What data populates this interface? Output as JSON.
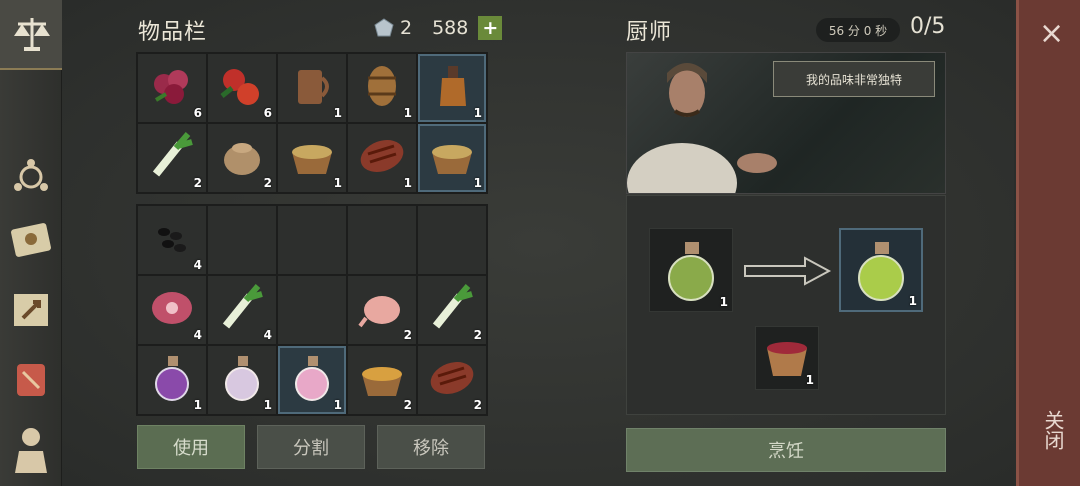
{
  "inventory": {
    "title": "物品栏",
    "gems": "2",
    "coins": "588",
    "add_label": "+",
    "row1": [
      {
        "icon": "berries-icon",
        "count": "6"
      },
      {
        "icon": "apples-icon",
        "count": "6"
      },
      {
        "icon": "mug-icon",
        "count": "1"
      },
      {
        "icon": "barrel-icon",
        "count": "1"
      },
      {
        "icon": "flask-icon",
        "count": "1",
        "selected": true
      }
    ],
    "row2": [
      {
        "icon": "leek-icon",
        "count": "2"
      },
      {
        "icon": "flour-sack-icon",
        "count": "2"
      },
      {
        "icon": "stew-bowl-icon",
        "count": "1"
      },
      {
        "icon": "steak-icon",
        "count": "1"
      },
      {
        "icon": "stew-bowl-icon",
        "count": "1",
        "selected": true
      }
    ],
    "row3": [
      {
        "icon": "black-seeds-icon",
        "count": "4"
      },
      {
        "icon": "",
        "count": ""
      },
      {
        "icon": "",
        "count": ""
      },
      {
        "icon": "",
        "count": ""
      },
      {
        "icon": "",
        "count": ""
      }
    ],
    "row4": [
      {
        "icon": "raw-meat-icon",
        "count": "4"
      },
      {
        "icon": "leek-icon",
        "count": "4"
      },
      {
        "icon": "",
        "count": ""
      },
      {
        "icon": "raw-chicken-icon",
        "count": "2"
      },
      {
        "icon": "leek-icon",
        "count": "2"
      }
    ],
    "row5": [
      {
        "icon": "purple-potion-icon",
        "count": "1"
      },
      {
        "icon": "white-potion-icon",
        "count": "1"
      },
      {
        "icon": "pink-potion-icon",
        "count": "1",
        "selected": true
      },
      {
        "icon": "soup-bowl-icon",
        "count": "2"
      },
      {
        "icon": "steak-icon",
        "count": "2"
      }
    ],
    "buttons": {
      "use": "使用",
      "split": "分割",
      "remove": "移除"
    }
  },
  "chef": {
    "title": "厨师",
    "timer": "56 分 0 秒",
    "progress": "0/5",
    "speech": "我的品味非常独特",
    "input_count": "1",
    "output_count": "1",
    "extra_count": "1",
    "cook_label": "烹饪"
  },
  "close": {
    "label": "关闭",
    "x": "×"
  },
  "colors": {
    "accent_border": "#4f6a7a",
    "close_bg": "#6b3a33",
    "button_green": "#5b6d52"
  }
}
